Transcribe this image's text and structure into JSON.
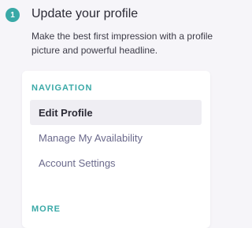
{
  "step": {
    "number": "1",
    "title": "Update your profile",
    "description": "Make the best first impression with a profile picture and powerful headline."
  },
  "navigation": {
    "heading": "NAVIGATION",
    "items": [
      {
        "label": "Edit Profile",
        "active": true
      },
      {
        "label": "Manage My Availability",
        "active": false
      },
      {
        "label": "Account Settings",
        "active": false
      }
    ]
  },
  "more": {
    "heading": "MORE"
  },
  "colors": {
    "accent": "#3aa9a7",
    "page_background": "#f6f5f9",
    "active_item_background": "#efeef3",
    "nav_text": "#6b6a8c"
  }
}
